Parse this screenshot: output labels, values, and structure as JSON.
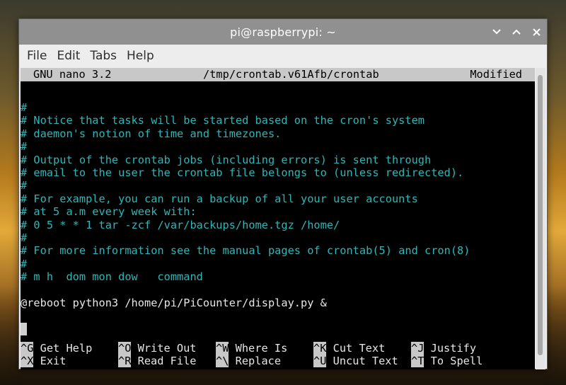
{
  "window": {
    "title": "pi@raspberrypi: ~"
  },
  "menubar": {
    "items": [
      "File",
      "Edit",
      "Tabs",
      "Help"
    ]
  },
  "nano": {
    "version": "GNU nano 3.2",
    "file": "/tmp/crontab.v61Afb/crontab",
    "status": "Modified"
  },
  "buffer": {
    "lines": [
      {
        "text": "#",
        "kind": "comment"
      },
      {
        "text": "# Notice that tasks will be started based on the cron's system",
        "kind": "comment"
      },
      {
        "text": "# daemon's notion of time and timezones.",
        "kind": "comment"
      },
      {
        "text": "#",
        "kind": "comment"
      },
      {
        "text": "# Output of the crontab jobs (including errors) is sent through",
        "kind": "comment"
      },
      {
        "text": "# email to the user the crontab file belongs to (unless redirected).",
        "kind": "comment"
      },
      {
        "text": "#",
        "kind": "comment"
      },
      {
        "text": "# For example, you can run a backup of all your user accounts",
        "kind": "comment"
      },
      {
        "text": "# at 5 a.m every week with:",
        "kind": "comment"
      },
      {
        "text": "# 0 5 * * 1 tar -zcf /var/backups/home.tgz /home/",
        "kind": "comment"
      },
      {
        "text": "#",
        "kind": "comment"
      },
      {
        "text": "# For more information see the manual pages of crontab(5) and cron(8)",
        "kind": "comment"
      },
      {
        "text": "#",
        "kind": "comment"
      },
      {
        "text": "# m h  dom mon dow   command",
        "kind": "comment"
      },
      {
        "text": "",
        "kind": "code"
      },
      {
        "text": "@reboot python3 /home/pi/PiCounter/display.py &",
        "kind": "code"
      },
      {
        "text": "",
        "kind": "code"
      }
    ]
  },
  "shortcuts": {
    "row1": [
      {
        "key": "^G",
        "label": "Get Help"
      },
      {
        "key": "^O",
        "label": "Write Out"
      },
      {
        "key": "^W",
        "label": "Where Is"
      },
      {
        "key": "^K",
        "label": "Cut Text"
      },
      {
        "key": "^J",
        "label": "Justify"
      }
    ],
    "row2": [
      {
        "key": "^X",
        "label": "Exit"
      },
      {
        "key": "^R",
        "label": "Read File"
      },
      {
        "key": "^\\",
        "label": "Replace"
      },
      {
        "key": "^U",
        "label": "Uncut Text"
      },
      {
        "key": "^T",
        "label": "To Spell"
      }
    ]
  },
  "colors": {
    "comment": "#2fb6b6",
    "titlebar": "#909090",
    "terminal_bg": "#000000",
    "header_bg": "#c8c8c8"
  },
  "icons": {
    "minimize": "chevron-down-icon",
    "maximize": "chevron-up-icon",
    "close": "close-icon"
  }
}
